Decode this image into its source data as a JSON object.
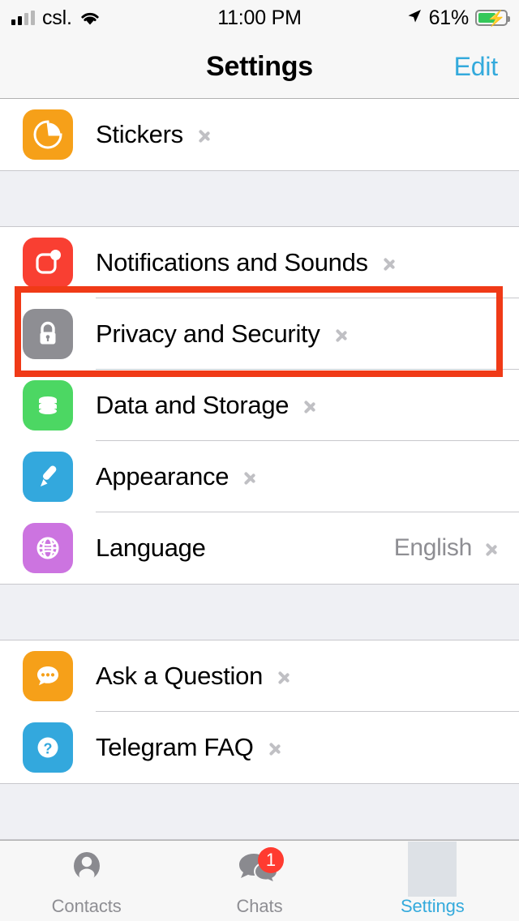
{
  "status_bar": {
    "carrier": "csl.",
    "time": "11:00 PM",
    "battery_percent": "61%",
    "signal_icon": "cellular-signal-icon",
    "wifi_icon": "wifi-icon",
    "location_icon": "location-arrow-icon",
    "battery_icon": "battery-charging-icon"
  },
  "navbar": {
    "title": "Settings",
    "edit_label": "Edit"
  },
  "sections": [
    {
      "rows": [
        {
          "label": "Stickers",
          "value": "",
          "icon": "stickers-icon",
          "icon_color": "#f6a019",
          "name": "settings-row-stickers"
        }
      ]
    },
    {
      "rows": [
        {
          "label": "Notifications and Sounds",
          "value": "",
          "icon": "notifications-icon",
          "icon_color": "#f93f32",
          "name": "settings-row-notifications-and-sounds"
        },
        {
          "label": "Privacy and Security",
          "value": "",
          "icon": "lock-icon",
          "icon_color": "#8e8e93",
          "name": "settings-row-privacy-and-security"
        },
        {
          "label": "Data and Storage",
          "value": "",
          "icon": "database-icon",
          "icon_color": "#4cd763",
          "name": "settings-row-data-and-storage"
        },
        {
          "label": "Appearance",
          "value": "",
          "icon": "paintbrush-icon",
          "icon_color": "#33a8dd",
          "name": "settings-row-appearance"
        },
        {
          "label": "Language",
          "value": "English",
          "icon": "globe-icon",
          "icon_color": "#cc74e0",
          "name": "settings-row-language"
        }
      ]
    },
    {
      "rows": [
        {
          "label": "Ask a Question",
          "value": "",
          "icon": "chat-bubble-icon",
          "icon_color": "#f6a019",
          "name": "settings-row-ask-a-question"
        },
        {
          "label": "Telegram FAQ",
          "value": "",
          "icon": "question-mark-icon",
          "icon_color": "#33a8dd",
          "name": "settings-row-telegram-faq"
        }
      ]
    }
  ],
  "tabbar": {
    "tabs": [
      {
        "label": "Contacts",
        "icon": "person-icon",
        "badge": "",
        "active": false
      },
      {
        "label": "Chats",
        "icon": "chats-icon",
        "badge": "1",
        "active": false
      },
      {
        "label": "Settings",
        "icon": "settings-tab-icon",
        "badge": "",
        "active": true
      }
    ]
  },
  "highlight": {
    "target": "Privacy and Security",
    "color": "#f03a17"
  },
  "colors": {
    "accent": "#34aadc",
    "separator": "#c8c8cc",
    "group_background": "#eff0f4",
    "secondary_text": "#8e8e93",
    "badge": "#ff3b30"
  }
}
